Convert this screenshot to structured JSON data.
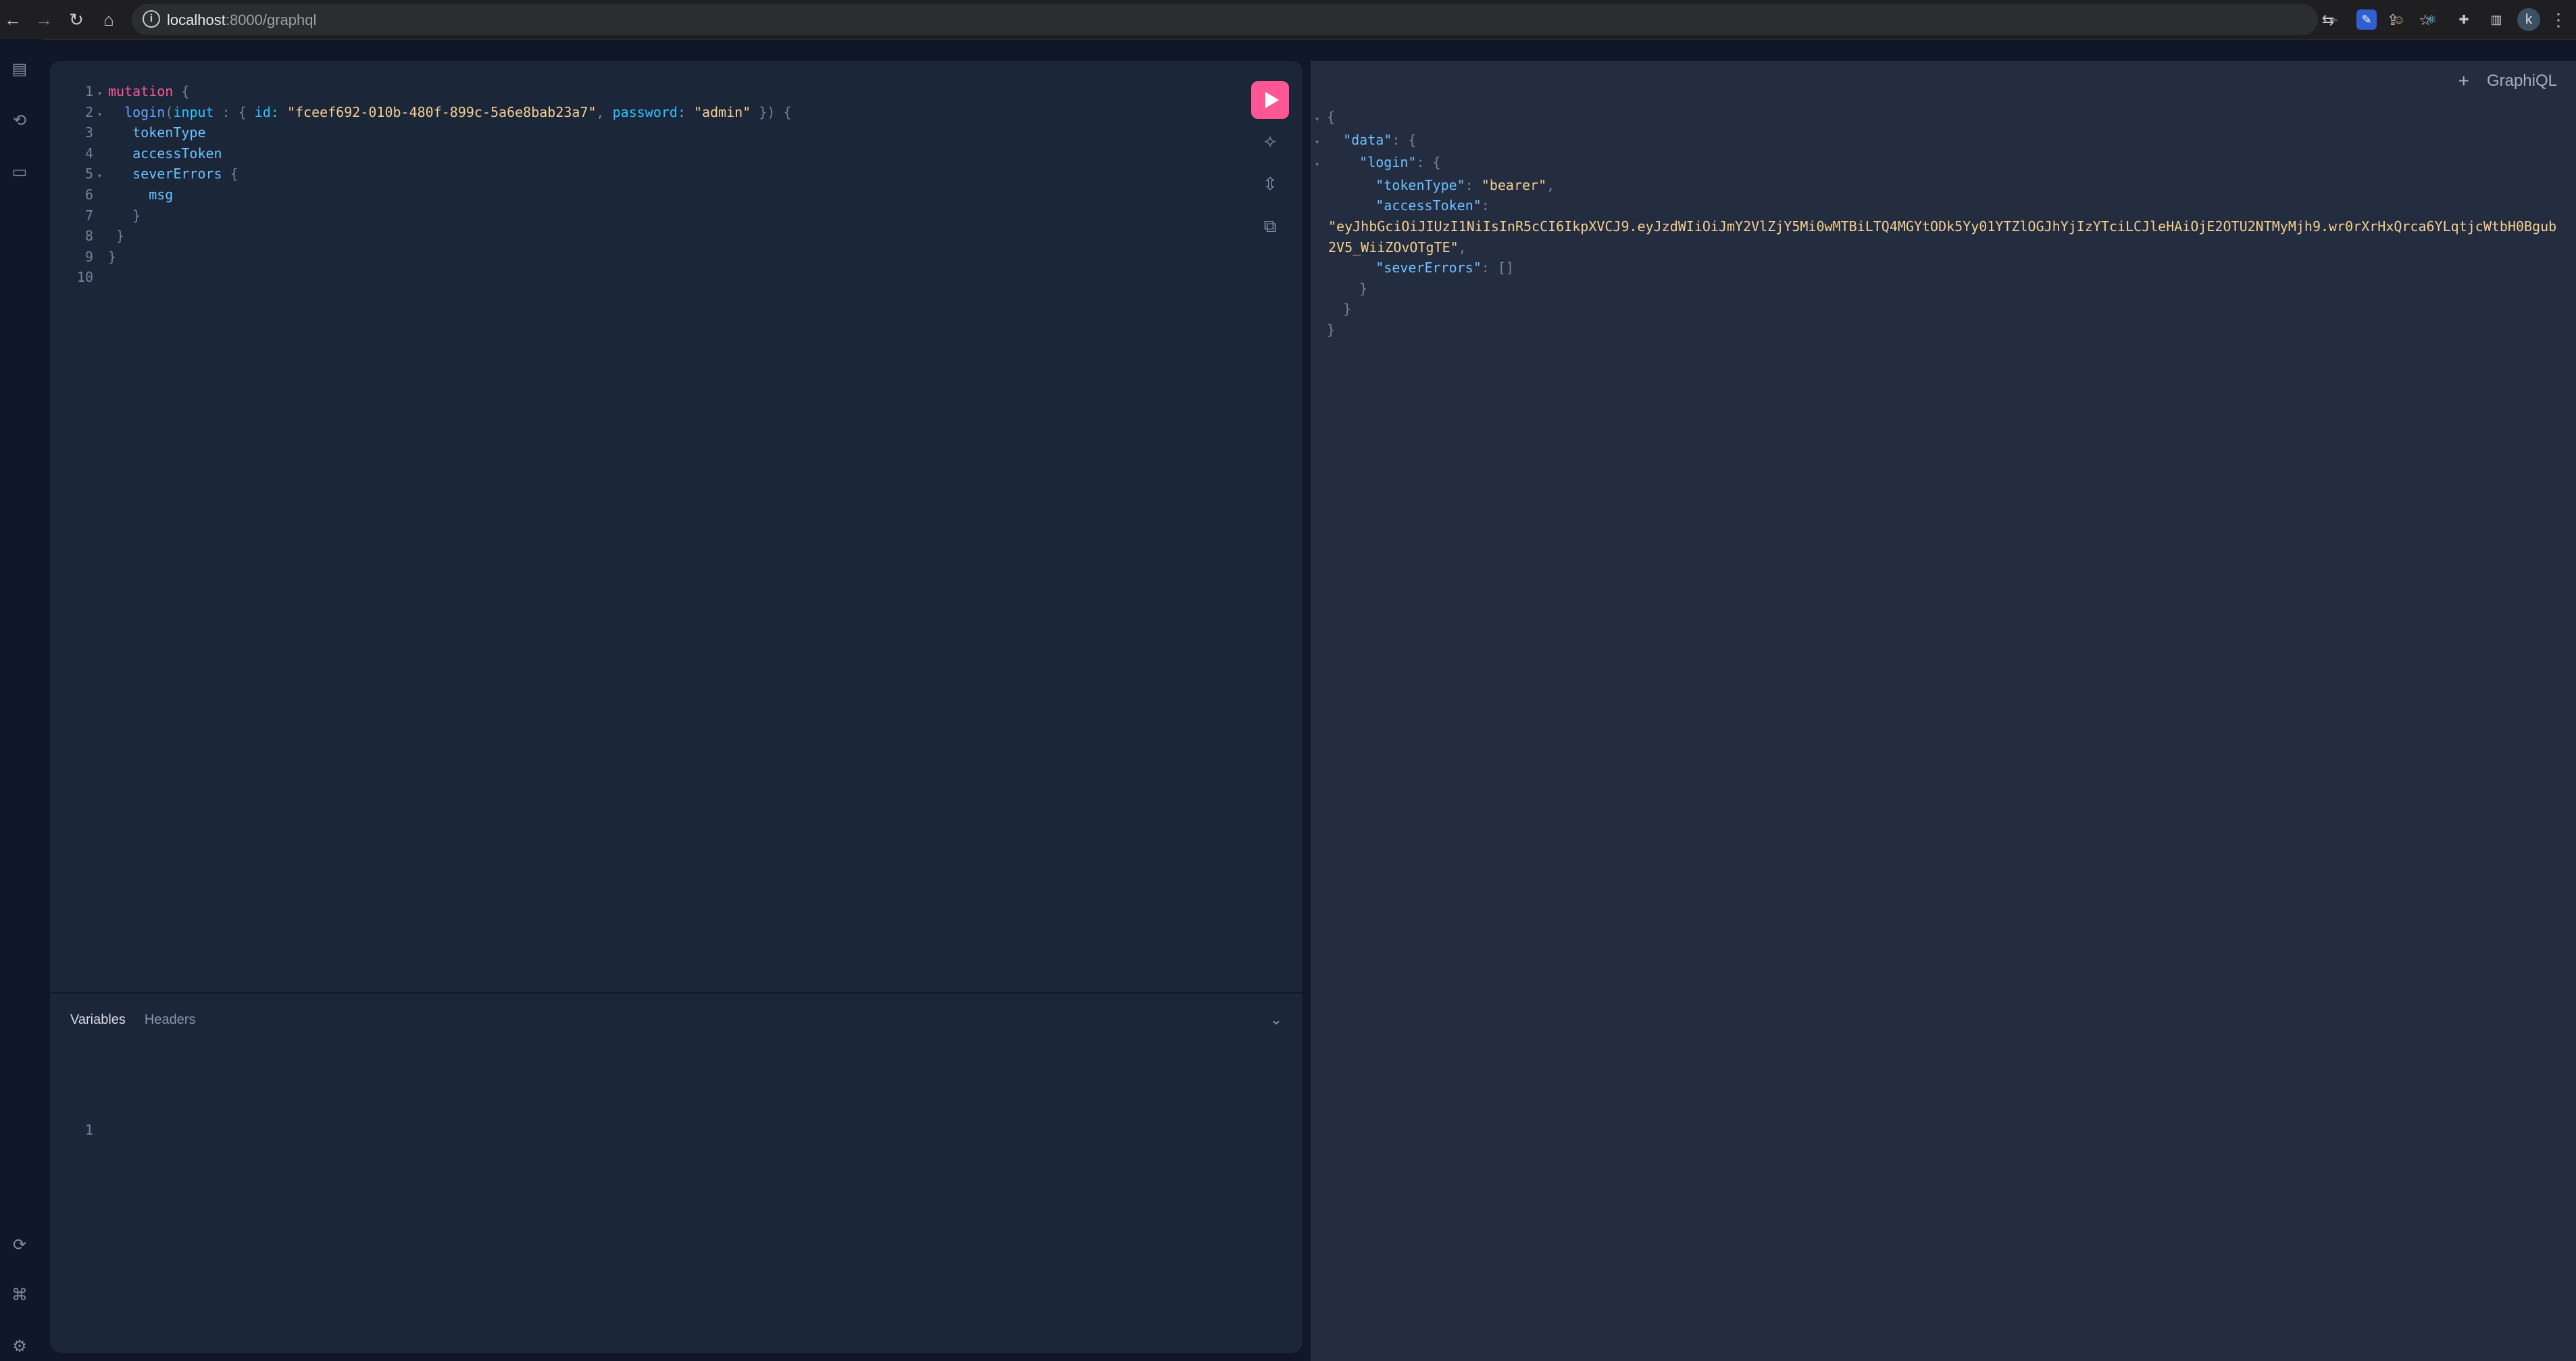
{
  "browser": {
    "url_host": "localhost",
    "url_rest": ":8000/graphql",
    "profile_initial": "k"
  },
  "editor": {
    "query_lines": [
      {
        "n": "1",
        "fold": "▾"
      },
      {
        "n": "2",
        "fold": "▾"
      },
      {
        "n": "3",
        "fold": ""
      },
      {
        "n": "4",
        "fold": ""
      },
      {
        "n": "5",
        "fold": "▾"
      },
      {
        "n": "6",
        "fold": ""
      },
      {
        "n": "7",
        "fold": ""
      },
      {
        "n": "8",
        "fold": ""
      },
      {
        "n": "9",
        "fold": ""
      },
      {
        "n": "10",
        "fold": ""
      }
    ],
    "tokens": {
      "mutation": "mutation",
      "login": "login",
      "input": "input",
      "id_key": "id:",
      "id_value": "\"fceef692-010b-480f-899c-5a6e8bab23a7\"",
      "password_key": "password:",
      "password_value": "\"admin\"",
      "tokenType": "tokenType",
      "accessToken": "accessToken",
      "severErrors": "severErrors",
      "msg": "msg"
    },
    "tabs": {
      "variables": "Variables",
      "headers": "Headers"
    },
    "variables_line": "1"
  },
  "result": {
    "title": "GraphiQL",
    "data_key": "\"data\"",
    "login_key": "\"login\"",
    "tokenType_key": "\"tokenType\"",
    "tokenType_value": "\"bearer\"",
    "accessToken_key": "\"accessToken\"",
    "accessToken_value": "\"eyJhbGciOiJIUzI1NiIsInR5cCI6IkpXVCJ9.eyJzdWIiOiJmY2VlZjY5Mi0wMTBiLTQ4MGYtODk5Yy01YTZlOGJhYjIzYTciLCJleHAiOjE2OTU2NTMyMjh9.wr0rXrHxQrca6YLqtjcWtbH0Bgub2V5_WiiZOvOTgTE\"",
    "severErrors_key": "\"severErrors\"",
    "severErrors_value": "[]"
  }
}
